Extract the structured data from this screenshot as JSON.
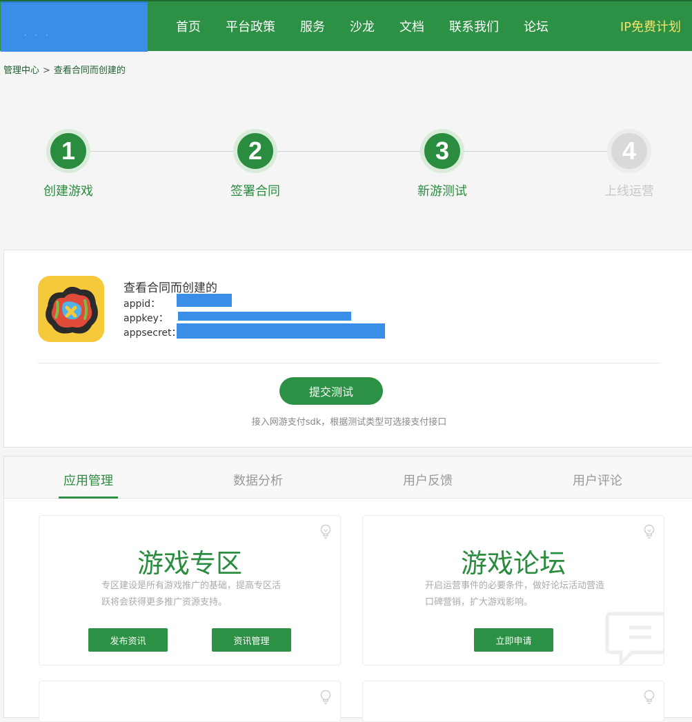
{
  "header": {
    "nav": [
      "首页",
      "平台政策",
      "服务",
      "沙龙",
      "文档",
      "联系我们",
      "论坛"
    ],
    "cta": "IP免费计划"
  },
  "breadcrumb": {
    "root": "管理中心",
    "separator": ">",
    "current": "查看合同而创建的"
  },
  "steps": [
    {
      "number": "1",
      "label": "创建游戏",
      "state": "done"
    },
    {
      "number": "2",
      "label": "签署合同",
      "state": "done"
    },
    {
      "number": "3",
      "label": "新游测试",
      "state": "current"
    },
    {
      "number": "4",
      "label": "上线运营",
      "state": "pending"
    }
  ],
  "game": {
    "name": "查看合同而创建的",
    "appid_label": "appid：",
    "appkey_label": "appkey：",
    "appsecret_label": "appsecret：",
    "submit_label": "提交测试",
    "submit_hint": "接入网游支付sdk，根据测试类型可选接支付接口"
  },
  "tabs": [
    {
      "label": "应用管理",
      "active": true
    },
    {
      "label": "数据分析",
      "active": false
    },
    {
      "label": "用户反馈",
      "active": false
    },
    {
      "label": "用户评论",
      "active": false
    }
  ],
  "features": [
    {
      "title": "游戏专区",
      "desc": "专区建设是所有游戏推广的基础，提高专区活跃将会获得更多推广资源支持。",
      "buttons": [
        "发布资讯",
        "资讯管理"
      ]
    },
    {
      "title": "游戏论坛",
      "desc": "开启运营事件的必要条件，做好论坛活动营造口碑营销，扩大游戏影响。",
      "buttons": [
        "立即申请"
      ]
    }
  ],
  "colors": {
    "brand_green": "#2d9145",
    "mask_blue": "#3a8ee8",
    "cta_yellow": "#f5e36b"
  }
}
